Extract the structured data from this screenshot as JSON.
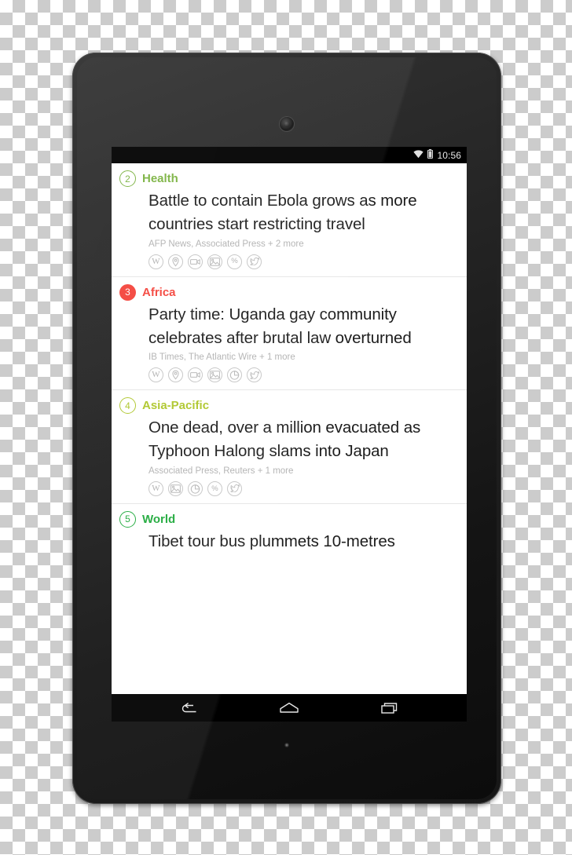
{
  "device": {
    "name": "android-tablet",
    "bezel_color": "#1f1f1f",
    "camera_label": "front-camera",
    "led_label": "notification-led"
  },
  "status_bar": {
    "time": "10:56",
    "wifi_icon": "wifi-icon",
    "battery_icon": "battery-icon"
  },
  "cards": [
    {
      "number": "2",
      "category": "Health",
      "color": "#7cb342",
      "badge_style": "outline",
      "headline": "Battle to contain Ebola grows as more countries start restricting travel",
      "sources": "AFP News, Associated Press + 2 more",
      "icons": [
        "wikipedia-icon",
        "location-pin-icon",
        "video-camera-icon",
        "image-icon",
        "percent-icon",
        "twitter-icon"
      ]
    },
    {
      "number": "3",
      "category": "Africa",
      "color": "#f4443c",
      "badge_style": "filled",
      "headline": "Party time: Uganda gay community celebrates after brutal law overturned",
      "sources": "IB Times, The Atlantic Wire + 1 more",
      "icons": [
        "wikipedia-icon",
        "location-pin-icon",
        "video-camera-icon",
        "image-icon",
        "pie-chart-icon",
        "twitter-icon"
      ]
    },
    {
      "number": "4",
      "category": "Asia-Pacific",
      "color": "#aec62a",
      "badge_style": "outline",
      "headline": "One dead, over a million evacuated as Typhoon Halong slams into Japan",
      "sources": "Associated Press, Reuters + 1 more",
      "icons": [
        "wikipedia-icon",
        "image-icon",
        "pie-chart-icon",
        "percent-icon",
        "twitter-icon"
      ]
    },
    {
      "number": "5",
      "category": "World",
      "color": "#1faa3c",
      "badge_style": "outline",
      "headline": "Tibet tour bus plummets 10-metres",
      "sources": "",
      "icons": []
    }
  ],
  "nav_bar": {
    "back_label": "back-button",
    "home_label": "home-button",
    "recents_label": "recents-button"
  }
}
